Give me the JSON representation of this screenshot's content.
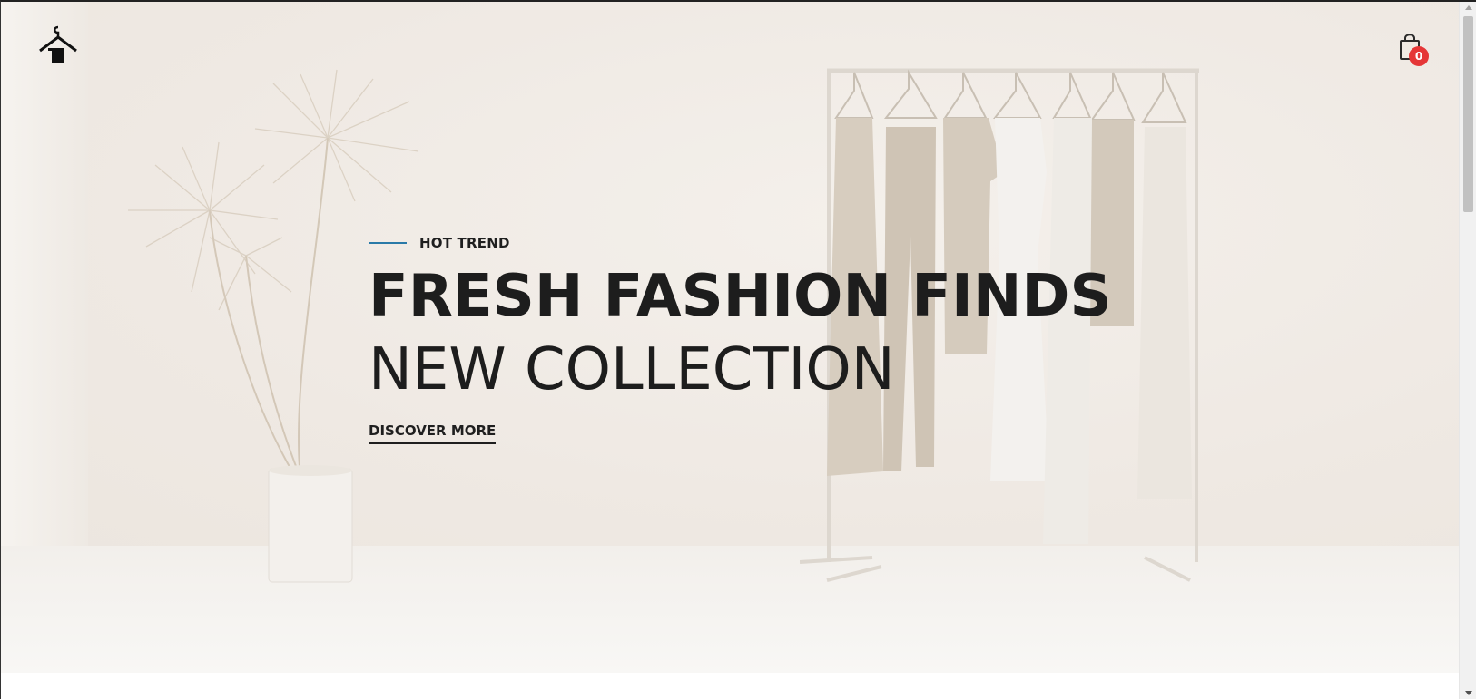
{
  "brand": {
    "logo_icon": "hanger-house-icon"
  },
  "header": {
    "cart_icon": "shopping-bag-icon",
    "cart_count": "0",
    "badge_color": "#e53637"
  },
  "hero": {
    "eyebrow": "HOT TREND",
    "eyebrow_accent": "#2a7aa8",
    "headline": "FRESH FASHION FINDS",
    "subline": "NEW COLLECTION",
    "cta_label": "DISCOVER MORE"
  }
}
